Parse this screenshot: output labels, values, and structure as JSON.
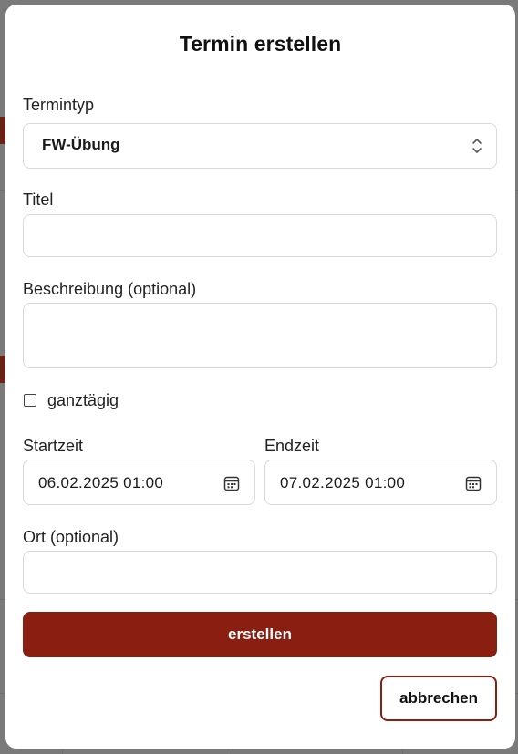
{
  "modal": {
    "title": "Termin erstellen"
  },
  "form": {
    "termintyp": {
      "label": "Termintyp",
      "value": "FW-Übung"
    },
    "titel": {
      "label": "Titel",
      "value": ""
    },
    "beschreibung": {
      "label": "Beschreibung (optional)",
      "value": ""
    },
    "ganztaegig": {
      "label": "ganztägig",
      "checked": false
    },
    "startzeit": {
      "label": "Startzeit",
      "value": "06.02.2025 01:00"
    },
    "endzeit": {
      "label": "Endzeit",
      "value": "07.02.2025 01:00"
    },
    "ort": {
      "label": "Ort (optional)",
      "value": ""
    }
  },
  "actions": {
    "submit_label": "erstellen",
    "cancel_label": "abbrechen"
  },
  "colors": {
    "accent": "#8a1f11",
    "overlay": "#7a7a7a",
    "border": "#d9d9d9"
  },
  "icons": {
    "select_chevron": "chevron-up-down-icon",
    "date_picker": "calendar-icon"
  }
}
